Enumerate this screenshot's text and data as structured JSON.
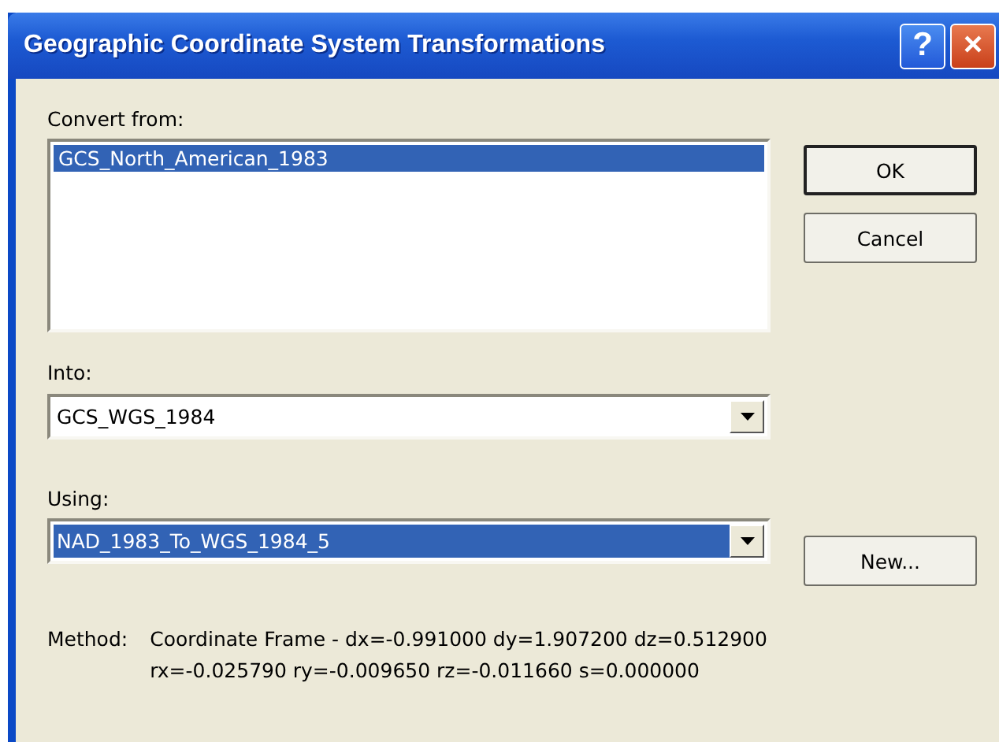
{
  "window": {
    "title": "Geographic Coordinate System Transformations",
    "help": "?",
    "close": "×"
  },
  "convert_from": {
    "label": "Convert from:",
    "items": [
      {
        "text": "GCS_North_American_1983",
        "selected": true
      }
    ]
  },
  "into": {
    "label": "Into:",
    "value": "GCS_WGS_1984",
    "selected": false
  },
  "using": {
    "label": "Using:",
    "value": "NAD_1983_To_WGS_1984_5",
    "selected": true
  },
  "buttons": {
    "ok": "OK",
    "cancel": "Cancel",
    "new": "New..."
  },
  "method": {
    "label": "Method:",
    "lines": [
      "Coordinate Frame - dx=-0.991000 dy=1.907200 dz=0.512900",
      "rx=-0.025790 ry=-0.009650 rz=-0.011660 s=0.000000"
    ]
  }
}
